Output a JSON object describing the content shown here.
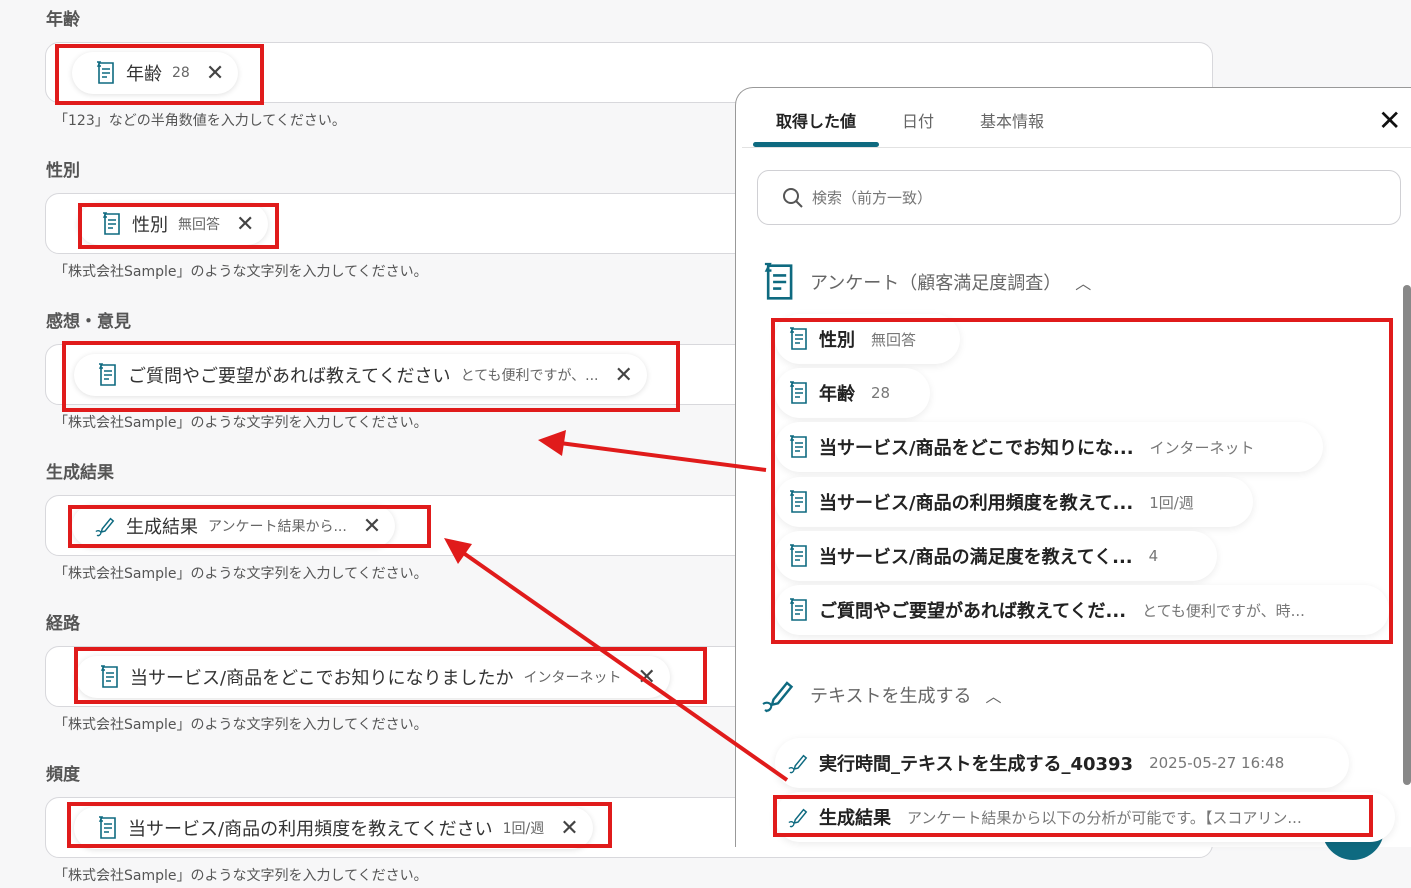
{
  "form": {
    "fields": [
      {
        "label": "年齢",
        "chip_name": "年齢",
        "chip_value": "28",
        "hint": "「123」などの半角数値を入力してください。",
        "icon": "form-icon"
      },
      {
        "label": "性別",
        "chip_name": "性別",
        "chip_value": "無回答",
        "hint": "「株式会社Sample」のような文字列を入力してください。",
        "icon": "form-icon"
      },
      {
        "label": "感想・意見",
        "chip_name": "ご質問やご要望があれば教えてください",
        "chip_value": "とても便利ですが、...",
        "hint": "「株式会社Sample」のような文字列を入力してください。",
        "icon": "form-icon"
      },
      {
        "label": "生成結果",
        "chip_name": "生成結果",
        "chip_value": "アンケート結果から...",
        "hint": "「株式会社Sample」のような文字列を入力してください。",
        "icon": "pen-icon"
      },
      {
        "label": "経路",
        "chip_name": "当サービス/商品をどこでお知りになりましたか",
        "chip_value": "インターネット",
        "hint": "「株式会社Sample」のような文字列を入力してください。",
        "icon": "form-icon"
      },
      {
        "label": "頻度",
        "chip_name": "当サービス/商品の利用頻度を教えてください",
        "chip_value": "1回/週",
        "hint": "「株式会社Sample」のような文字列を入力してください。",
        "icon": "form-icon"
      }
    ]
  },
  "panel": {
    "tabs": [
      "取得した値",
      "日付",
      "基本情報"
    ],
    "search_placeholder": "検索（前方一致）",
    "sections": [
      {
        "title": "アンケート（顧客満足度調査）",
        "items": [
          {
            "name": "性別",
            "value": "無回答"
          },
          {
            "name": "年齢",
            "value": "28"
          },
          {
            "name": "当サービス/商品をどこでお知りにな...",
            "value": "インターネット"
          },
          {
            "name": "当サービス/商品の利用頻度を教えて...",
            "value": "1回/週"
          },
          {
            "name": "当サービス/商品の満足度を教えてく...",
            "value": "4"
          },
          {
            "name": "ご質問やご要望があれば教えてくだ...",
            "value": "とても便利ですが、時..."
          }
        ]
      },
      {
        "title": "テキストを生成する",
        "items": [
          {
            "name": "実行時間_テキストを生成する_40393",
            "value": "2025-05-27 16:48"
          },
          {
            "name": "生成結果",
            "value": "アンケート結果から以下の分析が可能です。【スコアリン..."
          }
        ]
      }
    ]
  },
  "colors": {
    "accent": "#0e6a80",
    "highlight": "#e01b1b"
  }
}
